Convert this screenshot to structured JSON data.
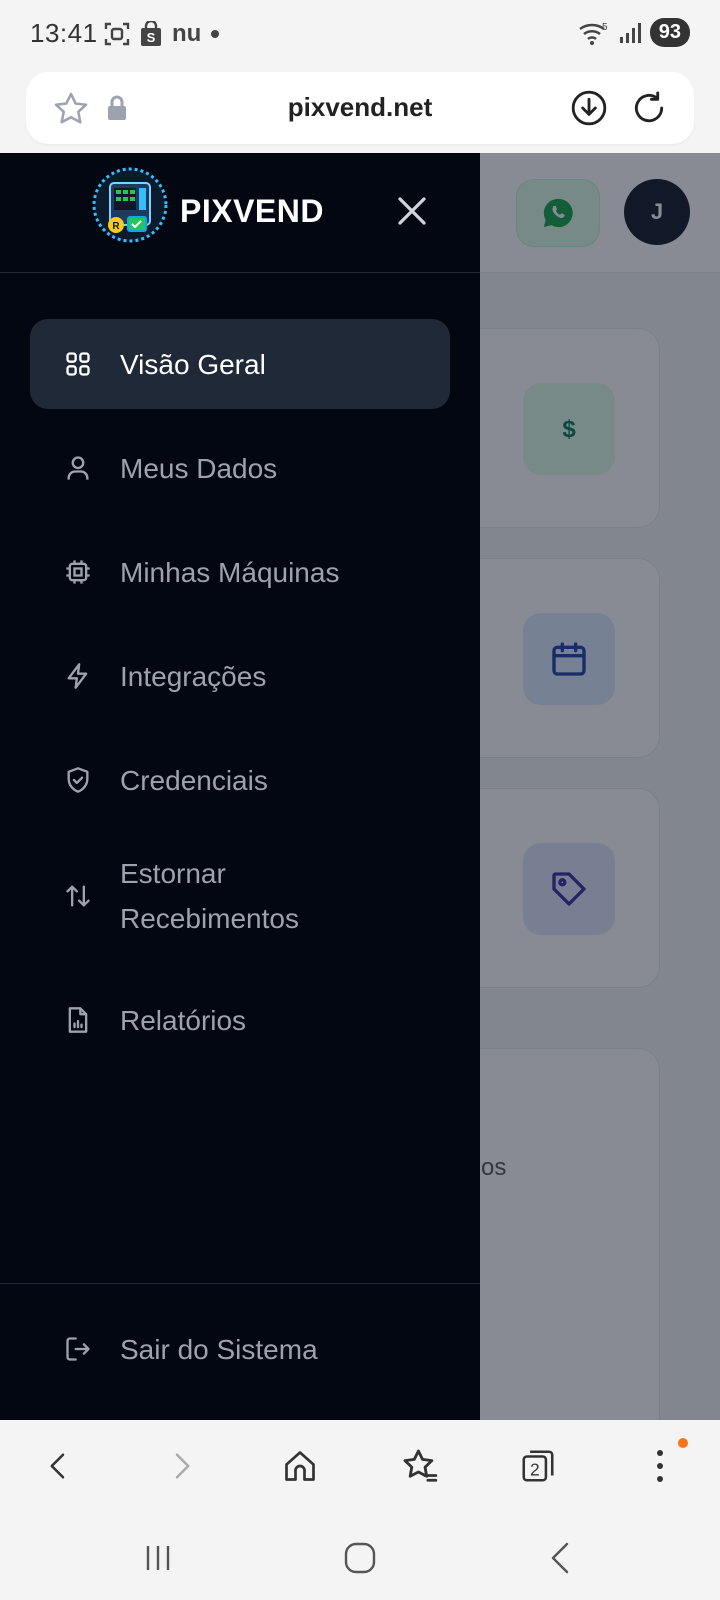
{
  "status_bar": {
    "time": "13:41",
    "carrier_glyph": "nu",
    "wifi_label": "5",
    "battery": "93"
  },
  "browser": {
    "url": "pixvend.net",
    "tab_count": "2"
  },
  "header": {
    "avatar_initial": "J"
  },
  "background": {
    "truncated_text": "os"
  },
  "drawer": {
    "brand": "PIXVEND",
    "nav_items": [
      {
        "label": "Visão Geral",
        "icon": "grid-icon",
        "active": true
      },
      {
        "label": "Meus Dados",
        "icon": "user-icon",
        "active": false
      },
      {
        "label": "Minhas Máquinas",
        "icon": "cpu-icon",
        "active": false
      },
      {
        "label": "Integrações",
        "icon": "lightning-icon",
        "active": false
      },
      {
        "label": "Credenciais",
        "icon": "shield-check-icon",
        "active": false
      },
      {
        "label": "Estornar Recebimentos",
        "icon": "arrows-up-down-icon",
        "active": false
      },
      {
        "label": "Relatórios",
        "icon": "report-icon",
        "active": false
      }
    ],
    "logout_label": "Sair do Sistema"
  },
  "colors": {
    "drawer_bg": "#030712",
    "active_item_bg": "#1f2937",
    "whatsapp_green": "#16a34a",
    "notification": "#f97316"
  }
}
